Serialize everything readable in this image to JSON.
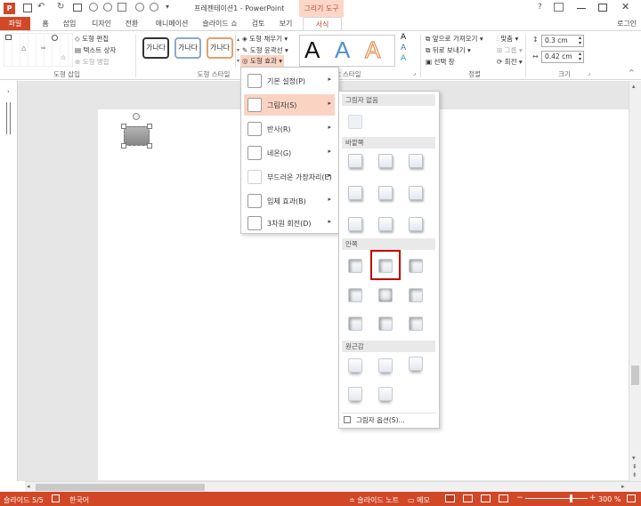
{
  "app": {
    "window_title": "프레젠테이션1 - PowerPoint",
    "tool_context": "그리기 도구",
    "user": "로그인",
    "accent": "#d24726"
  },
  "tabs": [
    "파일",
    "홈",
    "삽입",
    "디자인",
    "전환",
    "애니메이션",
    "슬라이드 쇼",
    "검토",
    "보기",
    "서식"
  ],
  "ribbon": {
    "insert_shapes": {
      "edit_shape": "도형 편집",
      "text_box": "텍스트 상자",
      "merge_shapes": "도형 병합",
      "label": "도형 삽입"
    },
    "shape_styles": {
      "presets": [
        "가나다",
        "가나다",
        "가나다"
      ],
      "fill": "도형 채우기",
      "outline": "도형 윤곽선",
      "effects": "도형 효과",
      "label": "도형 스타일"
    },
    "wordart": {
      "letters": [
        "A",
        "A",
        "A"
      ],
      "label": "WordArt 스타일"
    },
    "arrange": {
      "bring_forward": "앞으로 가져오기",
      "send_backward": "뒤로 보내기",
      "selection_pane": "선택 창",
      "align": "맞춤",
      "group": "그룹",
      "rotate": "회전",
      "label": "정렬"
    },
    "size": {
      "height": "0.3 cm",
      "width": "0.42 cm",
      "label": "크기"
    }
  },
  "effects_menu": [
    "기본 설정(P)",
    "그림자(S)",
    "반사(R)",
    "네온(G)",
    "부드러운 가장자리(E)",
    "입체 효과(B)",
    "3차원 회전(D)"
  ],
  "shadow_gallery": {
    "sections": [
      "그림자 없음",
      "바깥쪽",
      "안쪽",
      "원근감"
    ],
    "options_label": "그림자 옵션(S)..."
  },
  "statusbar": {
    "slide": "슬라이드 5/5",
    "language": "한국어",
    "notes": "슬라이드 노트",
    "comments": "메모",
    "zoom": "300 %"
  }
}
